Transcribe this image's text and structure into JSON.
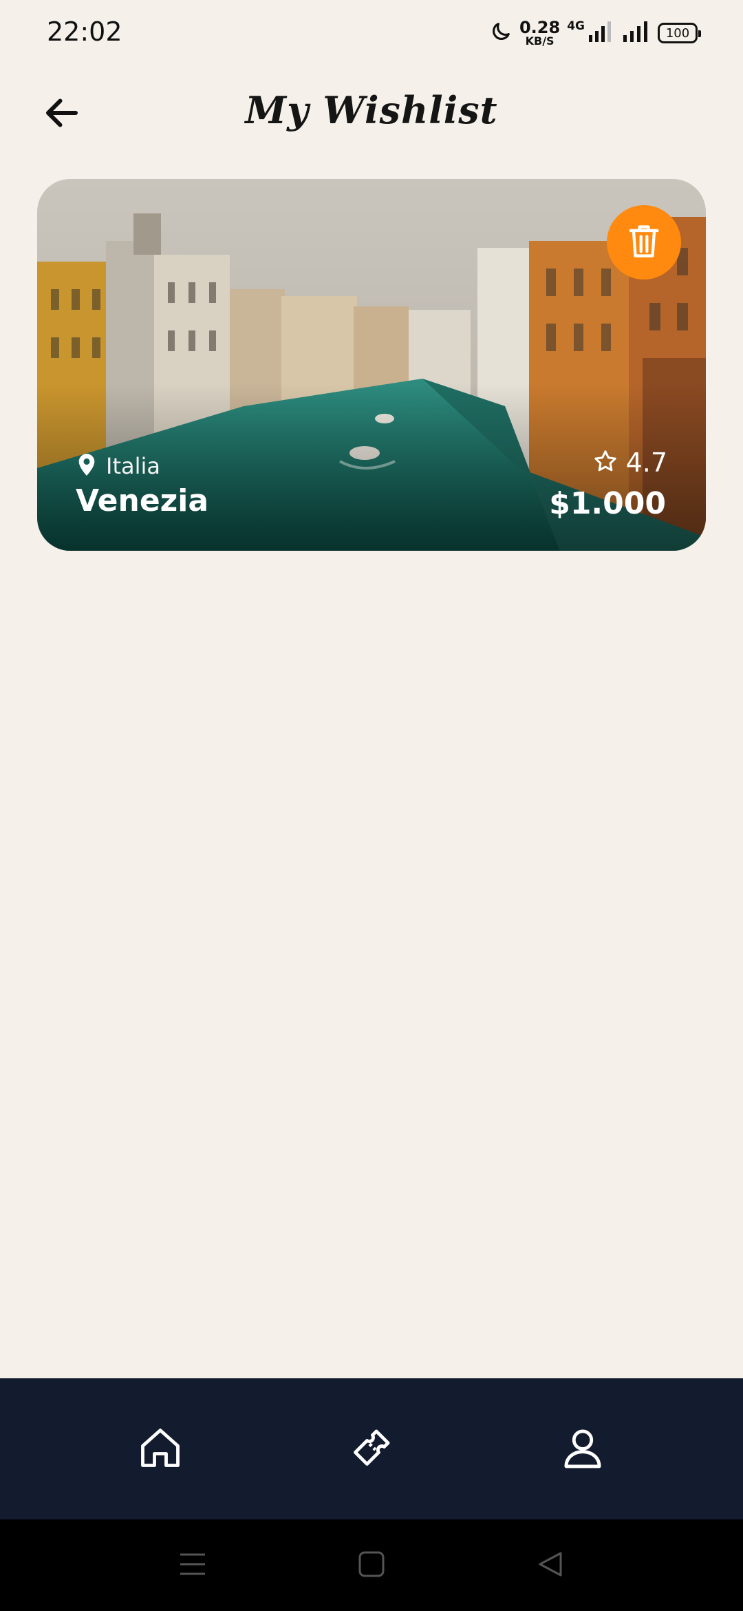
{
  "status_bar": {
    "time": "22:02",
    "speed_value": "0.28",
    "speed_unit": "KB/S",
    "network": "4G",
    "battery": "100"
  },
  "header": {
    "title": "My Wishlist",
    "back_icon": "arrow-left-icon"
  },
  "wishlist": [
    {
      "country": "Italia",
      "city": "Venezia",
      "rating": "4.7",
      "price": "$1.000",
      "delete_icon": "trash-icon",
      "location_icon": "map-pin-icon",
      "rating_icon": "star-outline-icon"
    }
  ],
  "bottom_nav": {
    "items": [
      "home-icon",
      "ticket-icon",
      "user-icon"
    ]
  },
  "colors": {
    "background": "#f5f1ea",
    "accent": "#ff8a0f",
    "nav_background": "#131b2e"
  }
}
